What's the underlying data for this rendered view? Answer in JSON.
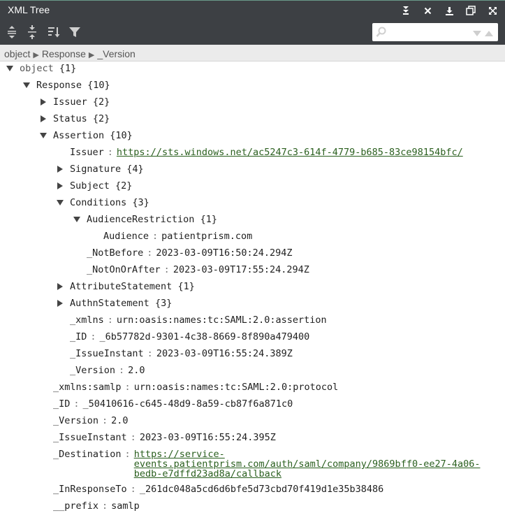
{
  "window": {
    "title": "XML Tree",
    "icons": [
      "collapse-down-icon",
      "close-icon",
      "download-icon",
      "copy-icon",
      "expand-window-icon"
    ]
  },
  "toolbar": {
    "tools": [
      "expand-all-icon",
      "collapse-all-icon",
      "sort-icon",
      "filter-icon"
    ],
    "search": {
      "value": "",
      "placeholder": ""
    }
  },
  "breadcrumb": [
    "object",
    "Response",
    "_Version"
  ],
  "tree": {
    "object": {
      "key": "object",
      "count": "{1}"
    },
    "response": {
      "key": "Response",
      "count": "{10}"
    },
    "issuer": {
      "key": "Issuer",
      "count": "{2}"
    },
    "status": {
      "key": "Status",
      "count": "{2}"
    },
    "assertion": {
      "key": "Assertion",
      "count": "{10}"
    },
    "a_issuer": {
      "key": "Issuer",
      "value": "https://sts.windows.net/ac5247c3-614f-4779-b685-83ce98154bfc/"
    },
    "signature": {
      "key": "Signature",
      "count": "{4}"
    },
    "subject": {
      "key": "Subject",
      "count": "{2}"
    },
    "conditions": {
      "key": "Conditions",
      "count": "{3}"
    },
    "audience_restriction": {
      "key": "AudienceRestriction",
      "count": "{1}"
    },
    "audience": {
      "key": "Audience",
      "value": "patientprism.com"
    },
    "not_before": {
      "key": "_NotBefore",
      "value": "2023-03-09T16:50:24.294Z"
    },
    "not_on_or_after": {
      "key": "_NotOnOrAfter",
      "value": "2023-03-09T17:55:24.294Z"
    },
    "attribute_statement": {
      "key": "AttributeStatement",
      "count": "{1}"
    },
    "authn_statement": {
      "key": "AuthnStatement",
      "count": "{3}"
    },
    "a_xmlns": {
      "key": "_xmlns",
      "value": "urn:oasis:names:tc:SAML:2.0:assertion"
    },
    "a_id": {
      "key": "_ID",
      "value": "_6b57782d-9301-4c38-8669-8f890a479400"
    },
    "a_issue_instant": {
      "key": "_IssueInstant",
      "value": "2023-03-09T16:55:24.389Z"
    },
    "a_version": {
      "key": "_Version",
      "value": "2.0"
    },
    "xmlns_samlp": {
      "key": "_xmlns:samlp",
      "value": "urn:oasis:names:tc:SAML:2.0:protocol"
    },
    "r_id": {
      "key": "_ID",
      "value": "_50410616-c645-48d9-8a59-cb87f6a871c0"
    },
    "r_version": {
      "key": "_Version",
      "value": "2.0"
    },
    "r_issue_instant": {
      "key": "_IssueInstant",
      "value": "2023-03-09T16:55:24.395Z"
    },
    "destination": {
      "key": "_Destination",
      "value": "https://service-events.patientprism.com/auth/saml/company/9869bff0-ee27-4a06-bedb-e7dffd23ad8a/callback",
      "lines": [
        "https://service-",
        "events.patientprism.com/auth/saml/company/9869bff0-ee27-4a06-",
        "bedb-e7dffd23ad8a/callback"
      ]
    },
    "in_response_to": {
      "key": "_InResponseTo",
      "value": "_261dc048a5cd6d6bfe5d73cbd70f419d1e35b38486"
    },
    "prefix": {
      "key": "__prefix",
      "value": "samlp"
    }
  },
  "colors": {
    "chrome": "#3d4044",
    "link": "#2a5f1e",
    "breadcrumb_bg": "#ebebeb"
  }
}
